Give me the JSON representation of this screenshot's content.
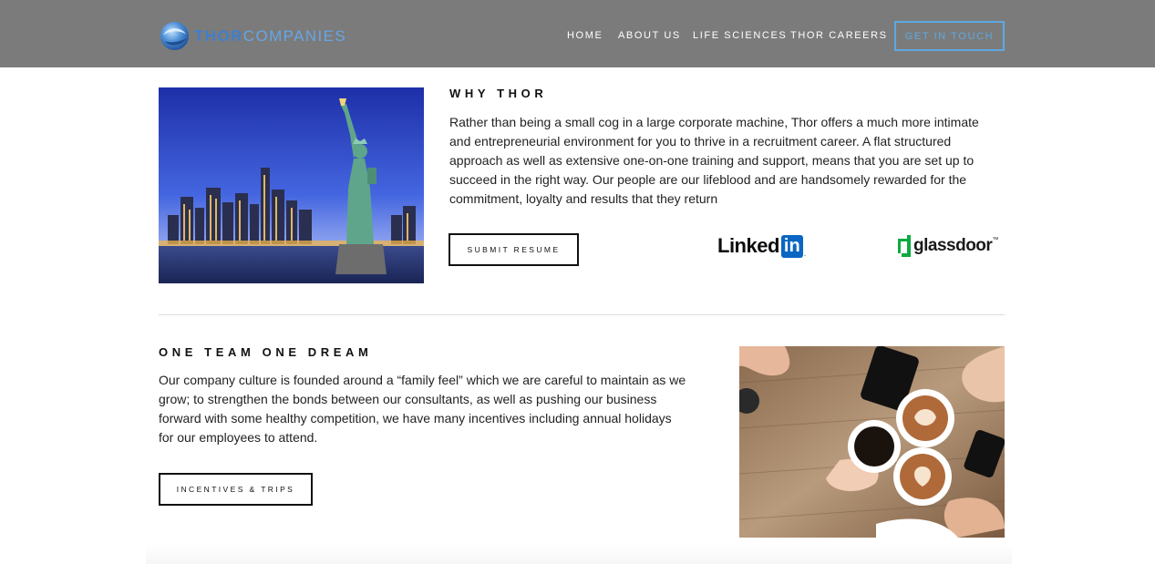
{
  "brand": {
    "thor": "THOR",
    "companies": "COMPANIES"
  },
  "nav": {
    "items": [
      "HOME",
      "ABOUT US",
      "LIFE SCIENCES",
      "THOR CAREERS"
    ],
    "cta": "GET IN TOUCH"
  },
  "why": {
    "title": "WHY THOR",
    "lines": [
      "Rather than being a small cog in a large corporate machine, Thor offers a much more intimate",
      "and entrepreneurial environment for you to thrive in a recruitment career. A flat structured",
      "approach as well as extensive one-on-one training and support, means that you are set up to",
      "succeed in the right way. Our people are our lifeblood and are handsomely rewarded for the",
      "commitment, loyalty and results that they return"
    ],
    "button": "SUBMIT RESUME",
    "linkedin": {
      "text": "Linked",
      "box": "in",
      "dot": "."
    },
    "glassdoor": {
      "text": "glassdoor",
      "tm": "™"
    }
  },
  "team": {
    "title": "ONE TEAM ONE DREAM",
    "lines": [
      "Our company culture is founded around a “family feel” which we are careful to maintain as we",
      "grow; to strengthen the bonds between our consultants, as well as pushing our business",
      "forward with some healthy competition, we have many incentives including annual holidays",
      "for our employees to attend."
    ],
    "button": "INCENTIVES & TRIPS"
  },
  "colors": {
    "header_bg": "#7b7b7b",
    "brand_blue": "#3f7fcf",
    "cta_blue": "#5fa8e0",
    "linkedin_blue": "#0a66c2",
    "glassdoor_green": "#0caa41"
  }
}
